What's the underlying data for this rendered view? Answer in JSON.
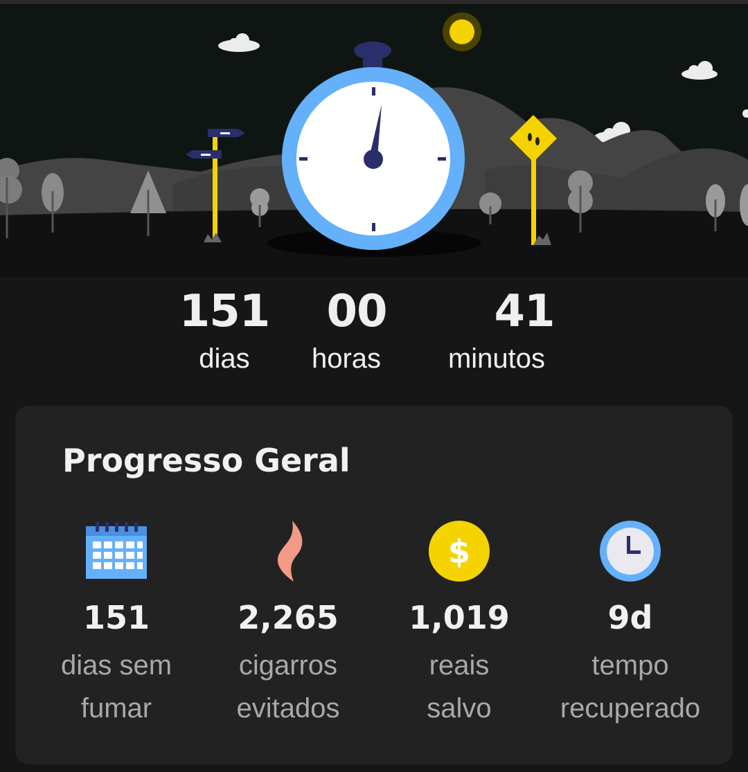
{
  "timer": {
    "days": "151",
    "days_label": "dias",
    "hours": "00",
    "hours_label": "horas",
    "minutes": "41",
    "minutes_label": "minutos"
  },
  "progress": {
    "title": "Progresso Geral",
    "stats": [
      {
        "value": "151",
        "label_line1": "dias sem",
        "label_line2": "fumar",
        "icon": "calendar-icon"
      },
      {
        "value": "2,265",
        "label_line1": "cigarros",
        "label_line2": "evitados",
        "icon": "flame-icon"
      },
      {
        "value": "1,019",
        "label_line1": "reais",
        "label_line2": "salvo",
        "icon": "dollar-coin-icon"
      },
      {
        "value": "9d",
        "label_line1": "tempo",
        "label_line2": "recuperado",
        "icon": "clock-icon"
      }
    ]
  },
  "colors": {
    "background": "#161616",
    "card": "#222222",
    "sky": "#0f1512",
    "stopwatch_ring": "#64b0fb",
    "accent_yellow": "#f5d300",
    "navy": "#24275a",
    "flame": "#f29a85"
  }
}
